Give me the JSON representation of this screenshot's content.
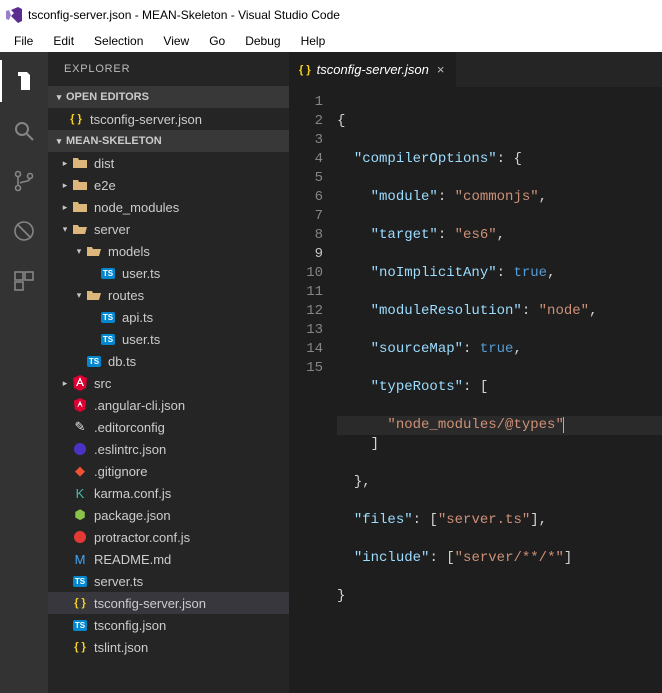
{
  "window": {
    "title": "tsconfig-server.json - MEAN-Skeleton - Visual Studio Code"
  },
  "menu": {
    "items": [
      "File",
      "Edit",
      "Selection",
      "View",
      "Go",
      "Debug",
      "Help"
    ]
  },
  "sidebar": {
    "title": "EXPLORER",
    "openEditors": {
      "label": "OPEN EDITORS",
      "items": [
        "tsconfig-server.json"
      ]
    },
    "project": {
      "label": "MEAN-SKELETON"
    },
    "tree": {
      "dist": "dist",
      "e2e": "e2e",
      "node_modules": "node_modules",
      "server": "server",
      "models": "models",
      "models_user": "user.ts",
      "routes": "routes",
      "routes_api": "api.ts",
      "routes_user": "user.ts",
      "db": "db.ts",
      "src": "src",
      "angularcli": ".angular-cli.json",
      "editorconfig": ".editorconfig",
      "eslintrc": ".eslintrc.json",
      "gitignore": ".gitignore",
      "karma": "karma.conf.js",
      "package": "package.json",
      "protractor": "protractor.conf.js",
      "readme": "README.md",
      "serverts": "server.ts",
      "tsconfigserver": "tsconfig-server.json",
      "tsconfig": "tsconfig.json",
      "tslint": "tslint.json"
    }
  },
  "tab": {
    "filename": "tsconfig-server.json"
  },
  "code": {
    "l1": "{",
    "l2k": "\"compilerOptions\"",
    "l2b": ": {",
    "l3k": "\"module\"",
    "l3v": "\"commonjs\"",
    "l4k": "\"target\"",
    "l4v": "\"es6\"",
    "l5k": "\"noImplicitAny\"",
    "l5v": "true",
    "l6k": "\"moduleResolution\"",
    "l6v": "\"node\"",
    "l7k": "\"sourceMap\"",
    "l7v": "true",
    "l8k": "\"typeRoots\"",
    "l8b": ": [",
    "l9v": "\"node_modules/@types\"",
    "l10": "]",
    "l11": "},",
    "l12k": "\"files\"",
    "l12v": "\"server.ts\"",
    "l13k": "\"include\"",
    "l13v": "\"server/**/*\"",
    "l14": "}"
  },
  "lineNumbers": [
    "1",
    "2",
    "3",
    "4",
    "5",
    "6",
    "7",
    "8",
    "9",
    "10",
    "11",
    "12",
    "13",
    "14",
    "15"
  ]
}
